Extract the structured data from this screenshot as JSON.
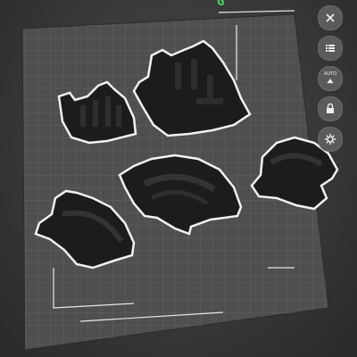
{
  "viewport": {
    "corner_label": "G",
    "plate_color": "#555555",
    "grid_color": "#6e6e6e",
    "outline_color": "#f2f2f2",
    "part_color": "#1c1c1c"
  },
  "toolbar": {
    "buttons": [
      {
        "icon": "close-icon"
      },
      {
        "icon": "list-icon"
      },
      {
        "icon": "auto-support-icon",
        "label": "AUTO"
      },
      {
        "icon": "lock-icon"
      },
      {
        "icon": "gear-icon"
      }
    ]
  },
  "parts": [
    {
      "name": "part-top-left"
    },
    {
      "name": "part-top-right"
    },
    {
      "name": "part-arch-left"
    },
    {
      "name": "part-arch-center"
    },
    {
      "name": "part-arch-right"
    }
  ]
}
